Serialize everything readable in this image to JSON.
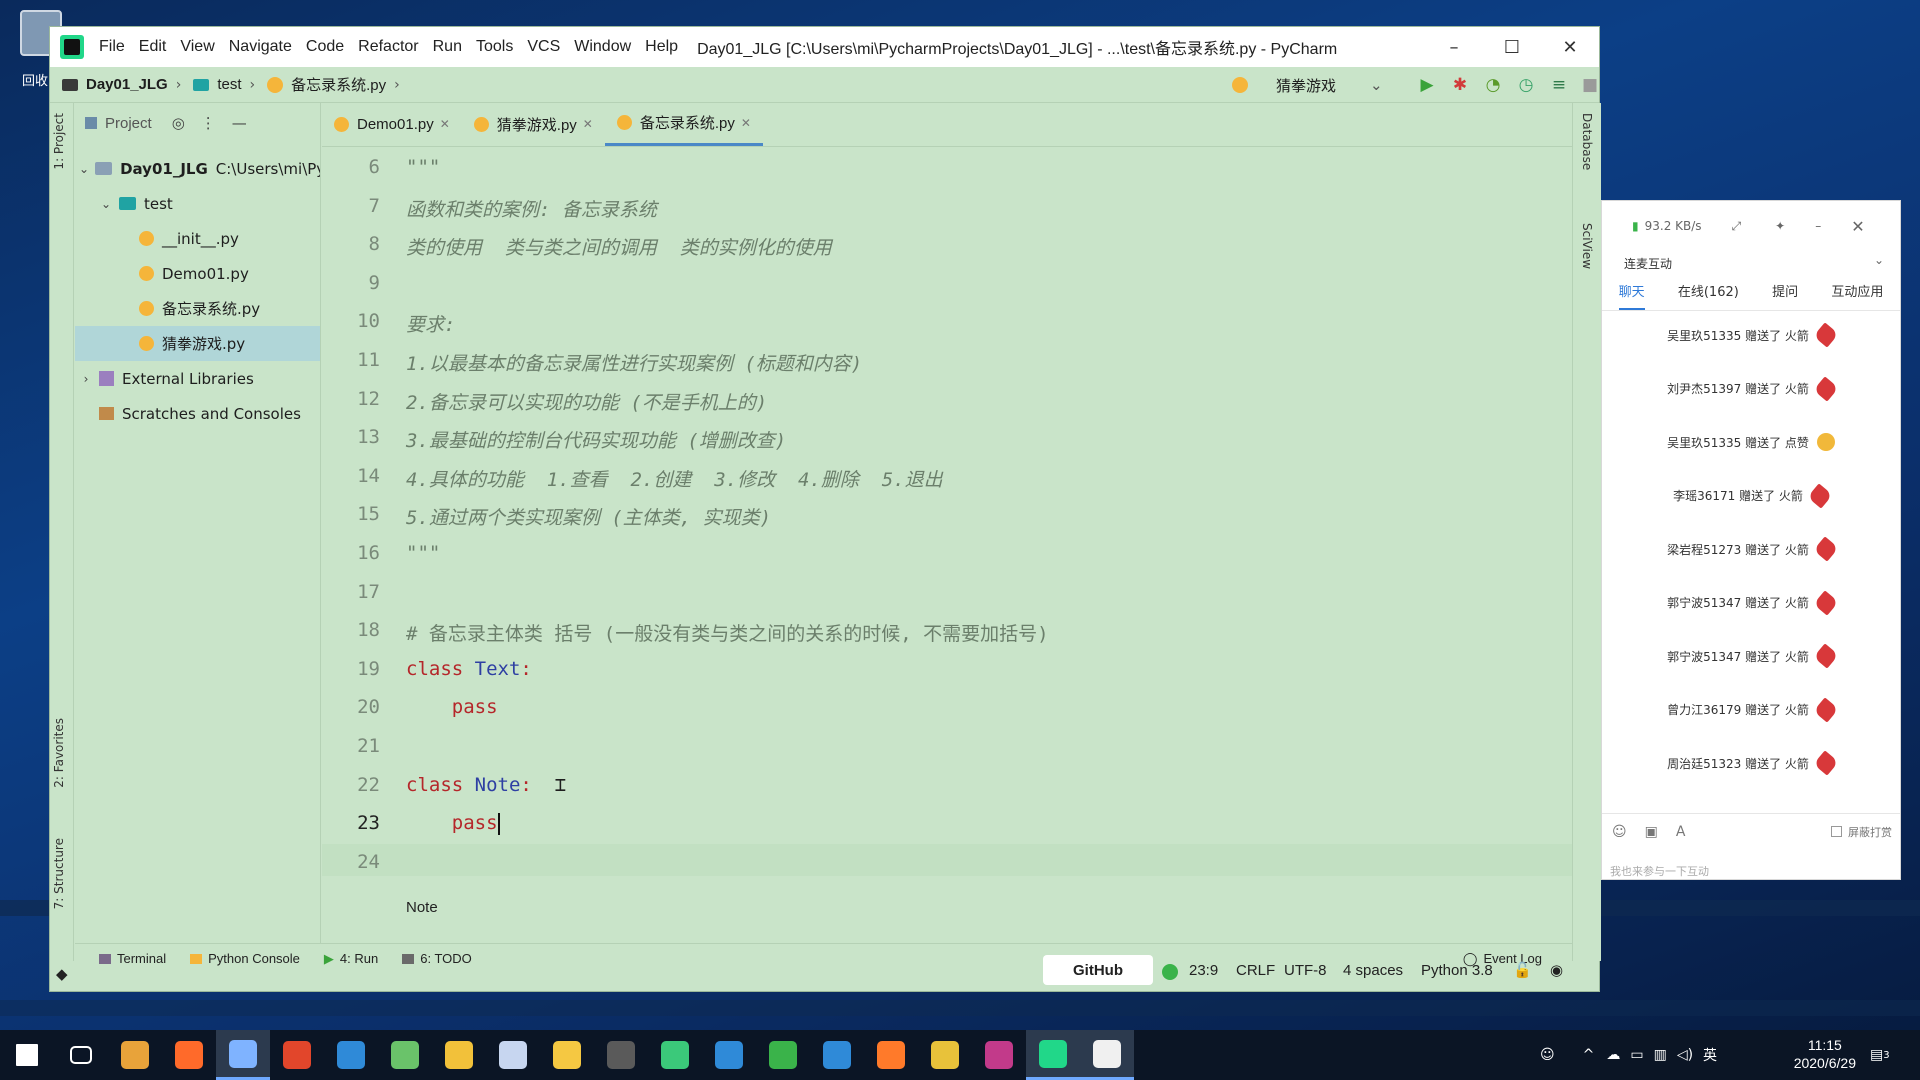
{
  "desktop": {
    "recycle_label": "回收"
  },
  "window": {
    "title": "Day01_JLG [C:\\Users\\mi\\PycharmProjects\\Day01_JLG] - ...\\test\\备忘录系统.py - PyCharm",
    "menu": [
      "File",
      "Edit",
      "View",
      "Navigate",
      "Code",
      "Refactor",
      "Run",
      "Tools",
      "VCS",
      "Window",
      "Help"
    ]
  },
  "navbar": {
    "project": "Day01_JLG",
    "folder": "test",
    "file": "备忘录系统.py",
    "run_config": "猜拳游戏"
  },
  "project_panel": {
    "title": "Project",
    "tree": [
      {
        "label": "Day01_JLG",
        "hint": "C:\\Users\\mi\\Py"
      },
      {
        "label": "test"
      },
      {
        "label": "__init__.py"
      },
      {
        "label": "Demo01.py"
      },
      {
        "label": "备忘录系统.py"
      },
      {
        "label": "猜拳游戏.py"
      },
      {
        "label": "External Libraries"
      },
      {
        "label": "Scratches and Consoles"
      }
    ]
  },
  "side_labels": {
    "project": "1: Project",
    "favorites": "2: Favorites",
    "structure": "7: Structure",
    "database": "Database",
    "sciview": "SciView"
  },
  "tabs": [
    {
      "label": "Demo01.py"
    },
    {
      "label": "猜拳游戏.py"
    },
    {
      "label": "备忘录系统.py"
    }
  ],
  "editor": {
    "lines": [
      {
        "n": "6",
        "text": "\"\"\""
      },
      {
        "n": "7",
        "text": "函数和类的案例: 备忘录系统"
      },
      {
        "n": "8",
        "text": "类的使用  类与类之间的调用  类的实例化的使用"
      },
      {
        "n": "9",
        "text": ""
      },
      {
        "n": "10",
        "text": "要求:"
      },
      {
        "n": "11",
        "text": "1.以最基本的备忘录属性进行实现案例 (标题和内容)"
      },
      {
        "n": "12",
        "text": "2.备忘录可以实现的功能 (不是手机上的)"
      },
      {
        "n": "13",
        "text": "3.最基础的控制台代码实现功能 (增删改查)"
      },
      {
        "n": "14",
        "text": "4.具体的功能  1.查看  2.创建  3.修改  4.删除  5.退出"
      },
      {
        "n": "15",
        "text": "5.通过两个类实现案例 (主体类, 实现类)"
      },
      {
        "n": "16",
        "text": "\"\"\""
      },
      {
        "n": "17",
        "text": ""
      },
      {
        "n": "18",
        "text": "# 备忘录主体类 括号 (一般没有类与类之间的关系的时候, 不需要加括号)"
      },
      {
        "n": "19",
        "kw": "class",
        "name": "Text",
        "colon": ":"
      },
      {
        "n": "20",
        "pass": "pass"
      },
      {
        "n": "21",
        "text": ""
      },
      {
        "n": "22",
        "kw": "class",
        "name": "Note",
        "colon": ":"
      },
      {
        "n": "23",
        "pass": "pass"
      },
      {
        "n": "24",
        "text": ""
      }
    ],
    "breadcrumb": "Note"
  },
  "bottom_tabs": [
    "Terminal",
    "Python Console",
    "4: Run",
    "6: TODO",
    "Event Log"
  ],
  "status": {
    "github": "GitHub",
    "position": "23:9",
    "line_sep": "CRLF",
    "encoding": "UTF-8",
    "indent": "4 spaces",
    "interpreter": "Python 3.8"
  },
  "chat": {
    "speed": "93.2 KB/s",
    "section": "连麦互动",
    "tabs": [
      "聊天",
      "在线(162)",
      "提问",
      "互动应用"
    ],
    "messages": [
      {
        "text": "吴里玖51335 赠送了 火箭",
        "gift": "rocket"
      },
      {
        "text": "刘尹杰51397 赠送了 火箭",
        "gift": "rocket"
      },
      {
        "text": "吴里玖51335 赠送了 点赞",
        "gift": "like"
      },
      {
        "text": "李瑶36171 赠送了 火箭",
        "gift": "rocket"
      },
      {
        "text": "梁岩程51273 赠送了 火箭",
        "gift": "rocket"
      },
      {
        "text": "郭宁波51347 赠送了 火箭",
        "gift": "rocket"
      },
      {
        "text": "郭宁波51347 赠送了 火箭",
        "gift": "rocket"
      },
      {
        "text": "曾力江36179 赠送了 火箭",
        "gift": "rocket"
      },
      {
        "text": "周治廷51323 赠送了 火箭",
        "gift": "rocket"
      }
    ],
    "block_label": "屏蔽打赏",
    "input_placeholder": "我也来参与一下互动"
  },
  "taskbar": {
    "apps": [
      "start-icon",
      "task-view-icon",
      "app-g-icon",
      "app-red-icon",
      "app-cloud-icon",
      "app-h-icon",
      "vscode-icon",
      "app-git-icon",
      "explorer-icon",
      "app-flower-icon",
      "app-pet-icon",
      "app-sublime-icon",
      "app-green-icon",
      "app-star-icon",
      "wechat-icon",
      "edge-icon",
      "firefox-icon",
      "chrome-icon",
      "intellij-icon",
      "pycharm-icon",
      "live-icon"
    ],
    "ime": "英",
    "time": "11:15",
    "date": "2020/6/29",
    "notif_count": "3"
  },
  "colors": {
    "editor_bg": "#c9e4c9",
    "keyword": "#b5262a",
    "class_name": "#2e3fa3",
    "accent": "#4a88c7"
  }
}
